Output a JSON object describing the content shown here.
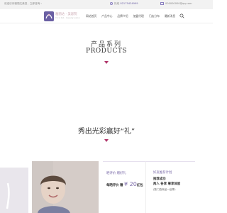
{
  "topbar": {
    "welcome": "欢迎访问雅丽达美容，立即咨询 ›",
    "hotline_label": "热线",
    "hotline_number": "02175424999",
    "email": "000000000@qq.com"
  },
  "header": {
    "logo_name": "雅丽达 · 美容院",
    "logo_sub": "YA LI DA · beauty salon",
    "nav": [
      "网站首页",
      "产品中心",
      "品牌介绍",
      "加盟代理",
      "门店分布",
      "最新消息"
    ]
  },
  "products_section": {
    "title": "产品系列",
    "subtitle": "PRODUCTS"
  },
  "slogan": "秀出光彩赢好“礼”",
  "offer": {
    "title": "晒评价 赠好礼",
    "line_prefix": "每晒评价 赠",
    "amount": "¥ 20",
    "line_suffix": "红包"
  },
  "plan": {
    "title": "好友推荐计划",
    "line1": "推荐成功",
    "line2": "两人 各享 尊享体验",
    "line3": "(数门查商品一起享)"
  },
  "colors": {
    "accent": "#7a6aa8",
    "arrow": "#b0356a",
    "topbar_bg": "#f2f2f2"
  }
}
